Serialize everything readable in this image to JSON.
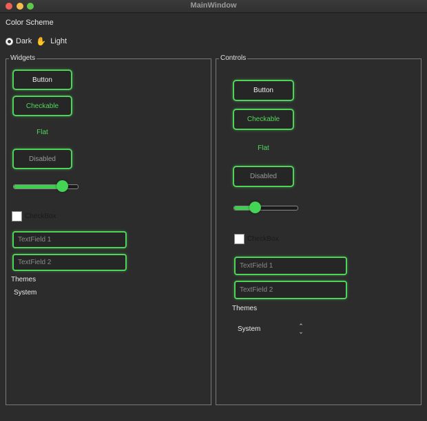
{
  "window": {
    "title": "MainWindow"
  },
  "color_scheme": {
    "label": "Color Scheme",
    "options": [
      {
        "label": "Dark",
        "checked": true
      },
      {
        "label": "Light",
        "checked": false
      }
    ]
  },
  "widgets": {
    "title": "Widgets",
    "button": "Button",
    "checkable": "Checkable",
    "flat": "Flat",
    "disabled": "Disabled",
    "slider_value": 0.75,
    "checkbox": "CheckBox",
    "textfield1_placeholder": "TextField 1",
    "textfield2_placeholder": "TextField 2",
    "themes_label": "Themes",
    "themes_value": "System"
  },
  "controls": {
    "title": "Controls",
    "button": "Button",
    "checkable": "Checkable",
    "flat": "Flat",
    "disabled": "Disabled",
    "slider_value": 0.33,
    "checkbox": "CheckBox",
    "textfield1_placeholder": "TextField 1",
    "textfield2_placeholder": "TextField 2",
    "themes_label": "Themes",
    "themes_value": "System"
  },
  "colors": {
    "accent": "#4fd45a",
    "background": "#2c2c2c"
  }
}
